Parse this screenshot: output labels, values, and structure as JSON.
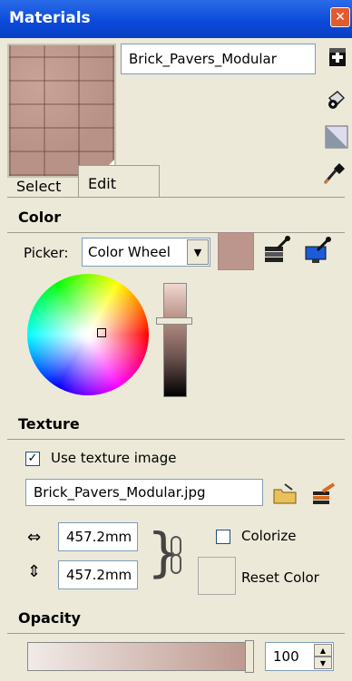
{
  "window": {
    "title": "Materials",
    "close_glyph": "✕"
  },
  "material": {
    "name": "Brick_Pavers_Modular"
  },
  "side_icons": [
    "create-material-icon",
    "paint-bucket-icon",
    "default-material-icon"
  ],
  "tabs": [
    {
      "label": "Select",
      "active": false
    },
    {
      "label": "Edit",
      "active": true
    }
  ],
  "color": {
    "section_label": "Color",
    "picker_label": "Picker:",
    "picker_value": "Color Wheel",
    "swatch_color": "#bc968c"
  },
  "texture": {
    "section_label": "Texture",
    "use_texture_label": "Use texture image",
    "use_texture_checked": true,
    "use_texture_mark": "✓",
    "filename": "Brick_Pavers_Modular.jpg",
    "width": "457.2mm",
    "height": "457.2mm",
    "colorize_label": "Colorize",
    "colorize_checked": false,
    "reset_color_label": "Reset Color"
  },
  "opacity": {
    "section_label": "Opacity",
    "value": "100"
  }
}
